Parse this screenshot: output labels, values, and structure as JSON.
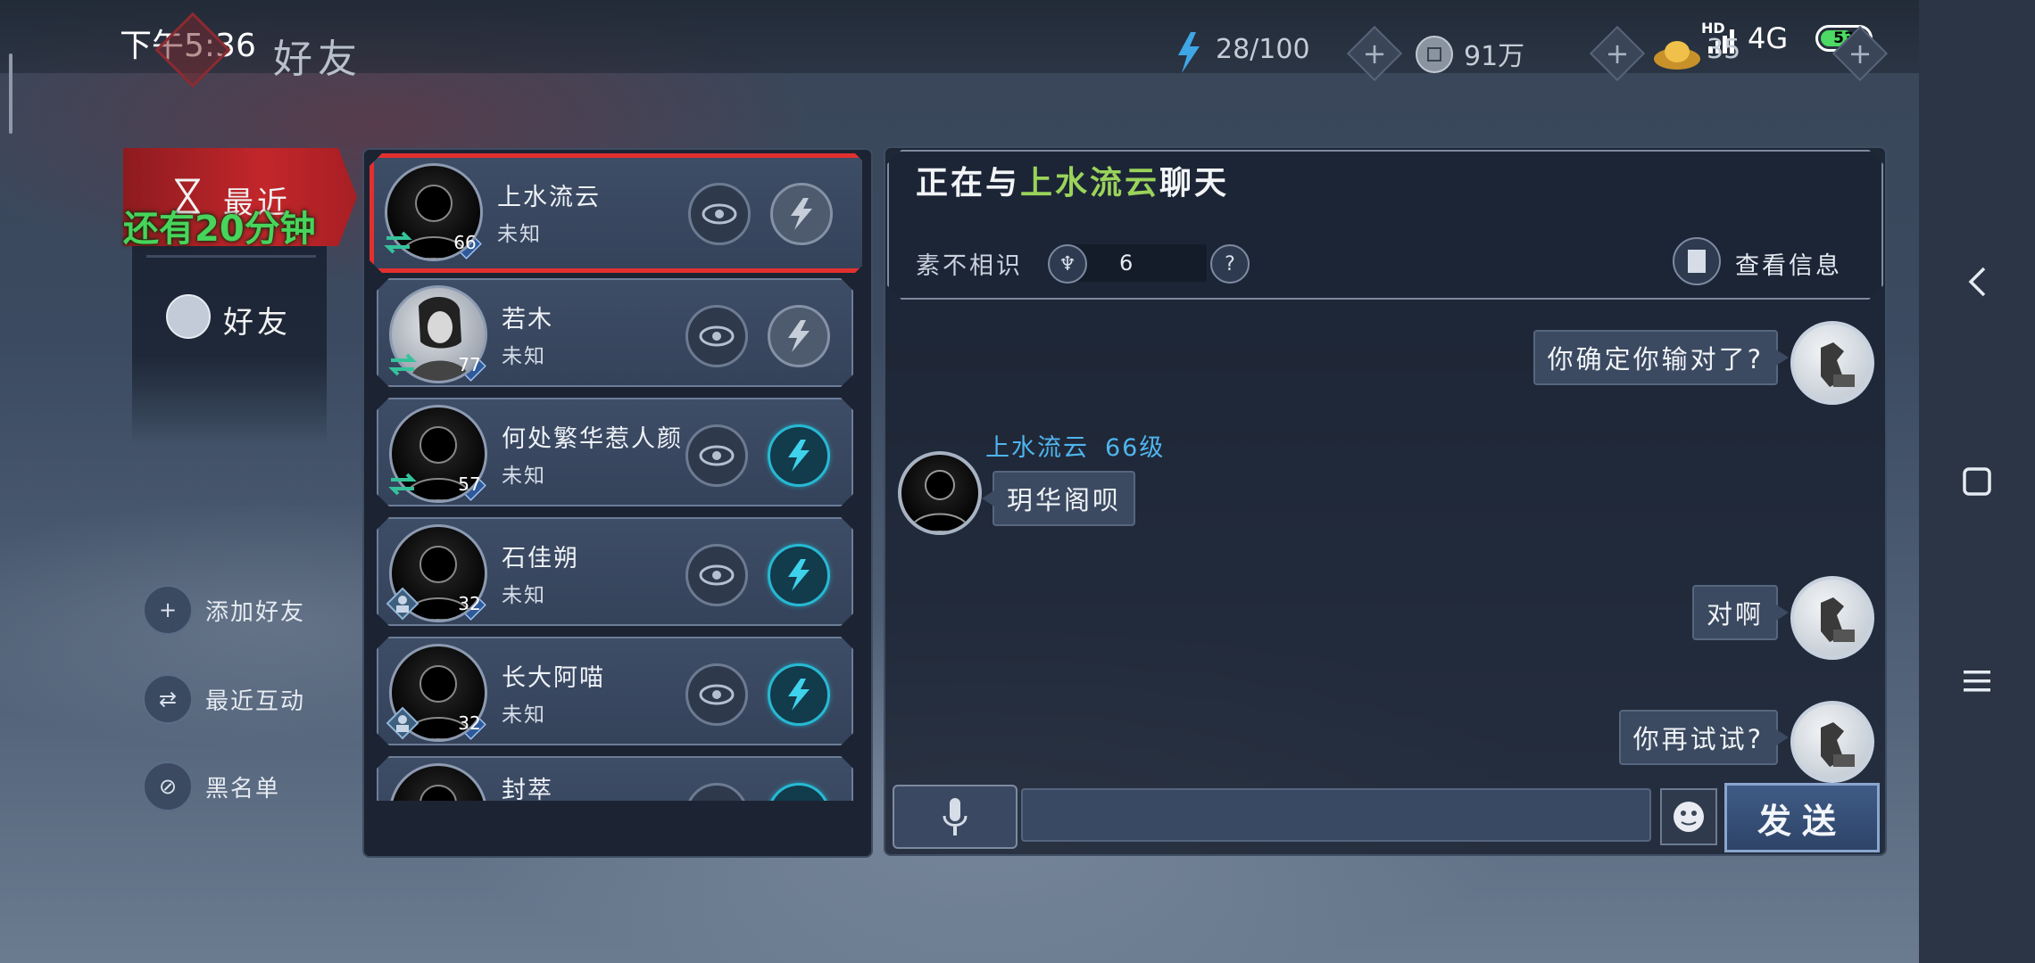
{
  "status_bar": {
    "time": "下午5:36",
    "hd": "HD",
    "network": "4G",
    "battery": "53"
  },
  "header": {
    "title": "好友",
    "stamina": "28/100",
    "coins": "91万",
    "gold": "35"
  },
  "sidebar": {
    "tabs": [
      {
        "label": "最近",
        "active": true
      },
      {
        "label": "好友",
        "active": false
      }
    ],
    "timer_text": "还有20分钟",
    "actions": [
      {
        "label": "添加好友",
        "icon": "add-friend-icon"
      },
      {
        "label": "最近互动",
        "icon": "swap-icon"
      },
      {
        "label": "黑名单",
        "icon": "blacklist-icon"
      }
    ]
  },
  "friends": [
    {
      "name": "上水流云",
      "status": "未知",
      "level": "66",
      "relation": "swap",
      "gift": "gray",
      "active": true
    },
    {
      "name": "若木",
      "status": "未知",
      "level": "77",
      "relation": "swap",
      "gift": "gray",
      "active": false
    },
    {
      "name": "何处繁华惹人颜",
      "status": "未知",
      "level": "57",
      "relation": "swap",
      "gift": "teal",
      "active": false
    },
    {
      "name": "石佳朔",
      "status": "未知",
      "level": "32",
      "relation": "person",
      "gift": "teal",
      "active": false
    },
    {
      "name": "长大阿喵",
      "status": "未知",
      "level": "32",
      "relation": "person",
      "gift": "teal",
      "active": false
    },
    {
      "name": "封萃",
      "status": "",
      "level": "",
      "relation": "",
      "gift": "teal",
      "active": false
    }
  ],
  "chat": {
    "title_prefix": "正在与",
    "title_name": "上水流云",
    "title_suffix": "聊天",
    "relation_label": "素不相识",
    "intimacy": "6",
    "help_label": "?",
    "view_info": "查看信息",
    "sender_name": "上水流云",
    "sender_level": "66级",
    "messages": [
      {
        "side": "mine",
        "text": "你确定你输对了?"
      },
      {
        "side": "theirs",
        "text": "玥华阁呗"
      },
      {
        "side": "mine",
        "text": "对啊"
      },
      {
        "side": "mine",
        "text": "你再试试?"
      }
    ],
    "input_placeholder": "",
    "send_label": "发送"
  },
  "colors": {
    "accent_red": "#e2302f",
    "name_green": "#9ad35a",
    "sender_blue": "#4fb5ee",
    "timer_green": "#47d45a"
  }
}
